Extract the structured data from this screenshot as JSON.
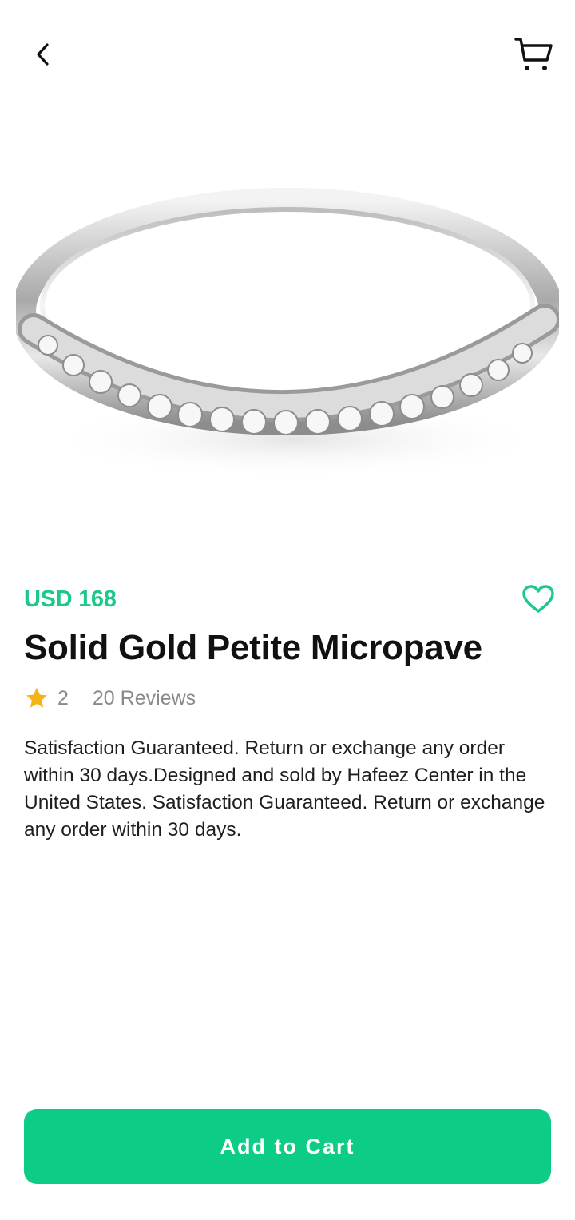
{
  "header": {
    "back_icon": "chevron-left-icon",
    "cart_icon": "shopping-cart-icon"
  },
  "product": {
    "image_alt": "silver micropave ring",
    "price": "USD 168",
    "title": "Solid Gold Petite Micropave",
    "rating": "2",
    "reviews": "20 Reviews",
    "description": "Satisfaction Guaranteed. Return or exchange any order within 30 days.Designed and sold by Hafeez Center in the United States. Satisfaction Guaranteed. Return or exchange any order within 30 days.",
    "favorite_icon": "heart-outline-icon",
    "rating_icon": "star-icon"
  },
  "actions": {
    "add_to_cart_label": "Add to Cart"
  },
  "colors": {
    "accent": "#0dcd86",
    "price": "#1dc98a",
    "star": "#f6b318",
    "muted_text": "#8a8a8a"
  }
}
